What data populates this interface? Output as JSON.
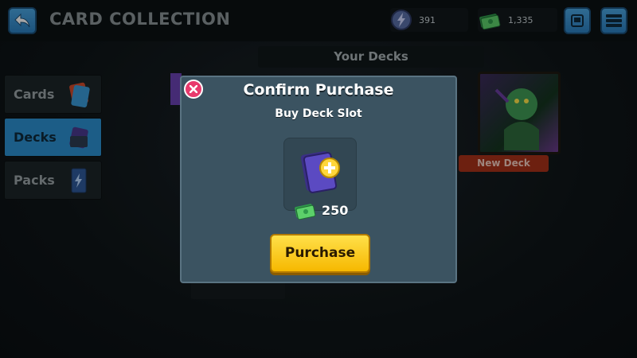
{
  "header": {
    "title": "CARD COLLECTION",
    "energy_value": "391",
    "cash_value": "1,335"
  },
  "section": {
    "your_decks_label": "Your Decks"
  },
  "sidebar": {
    "items": [
      {
        "label": "Cards",
        "active": false
      },
      {
        "label": "Decks",
        "active": true
      },
      {
        "label": "Packs",
        "active": false
      }
    ]
  },
  "deck_list": {
    "new_deck_label": "New Deck"
  },
  "modal": {
    "title": "Confirm Purchase",
    "subtitle": "Buy Deck Slot",
    "price": "250",
    "purchase_label": "Purchase"
  },
  "colors": {
    "accent": "#2b8fcf",
    "purchase": "#f6b800",
    "close": "#e83a6d",
    "modal_bg": "#3b5361"
  }
}
